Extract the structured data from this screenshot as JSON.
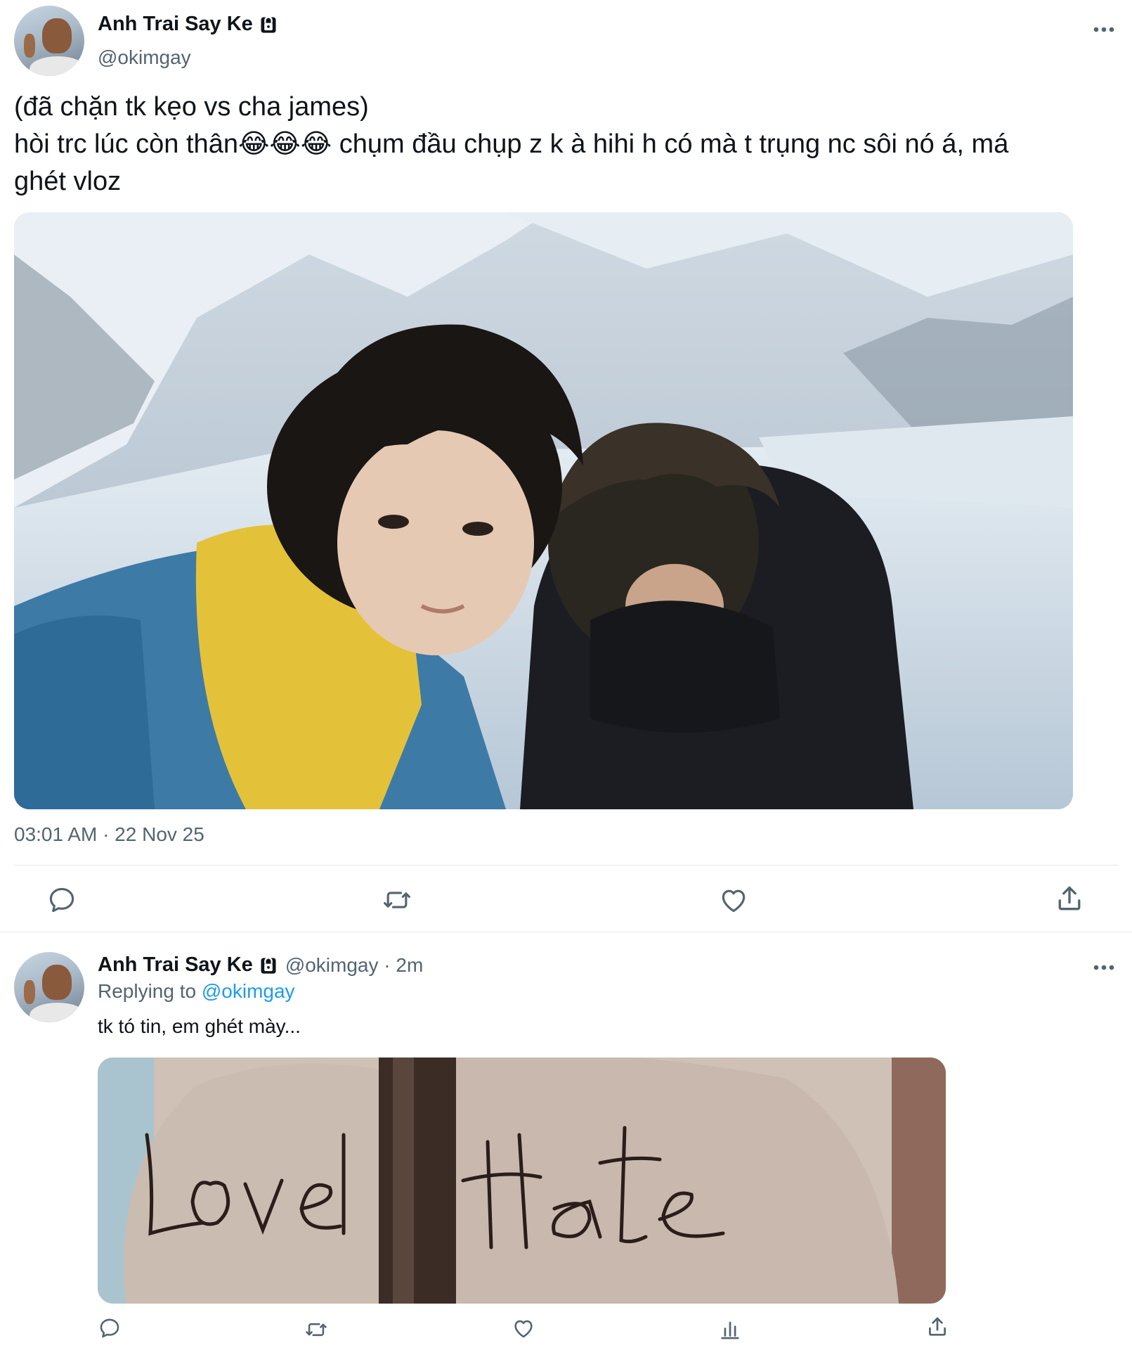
{
  "main_tweet": {
    "display_name": "Anh Trai Say Ke",
    "handle": "@okimgay",
    "text_lines": [
      "(đã chặn tk kẹo vs cha james)",
      "hòi trc lúc còn thân😂😂😂 chụm đầu chụp z k à hihi h có mà t trụng nc sôi nó á, má",
      "ghét vloz"
    ],
    "timestamp": "03:01 AM · 22 Nov 25",
    "icons": {
      "lock": "lock-icon",
      "more": "more-icon",
      "reply": "reply-icon",
      "retweet": "retweet-icon",
      "like": "heart-icon",
      "share": "share-icon"
    }
  },
  "reply_tweet": {
    "display_name": "Anh Trai Say Ke",
    "handle_meta": "@okimgay · 2m",
    "replying_prefix": "Replying to",
    "replying_mention": "@okimgay",
    "text": "tk tó tin, em ghét mày...",
    "icons": {
      "reply": "reply-icon",
      "retweet": "retweet-icon",
      "like": "heart-icon",
      "views": "views-icon",
      "share": "share-icon"
    }
  },
  "colors": {
    "text_primary": "#0f1419",
    "text_secondary": "#536471",
    "link": "#1d9bf0",
    "divider": "#e6e9ec"
  }
}
